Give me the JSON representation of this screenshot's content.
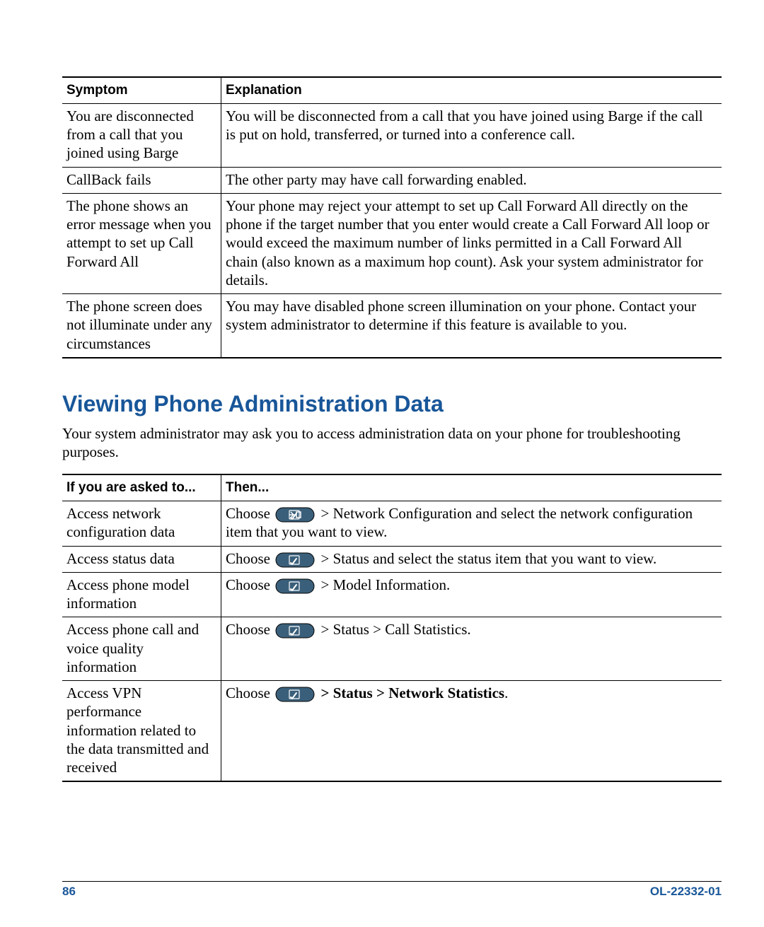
{
  "table1": {
    "headers": [
      "Symptom",
      "Explanation"
    ],
    "rows": [
      {
        "symptom": "You are disconnected from a call that you joined using Barge",
        "explanation": "You will be disconnected from a call that you have joined using Barge if the call is put on hold, transferred, or turned into a conference call."
      },
      {
        "symptom": "CallBack fails",
        "explanation": "The other party may have call forwarding enabled."
      },
      {
        "symptom": "The phone shows an error message when you attempt to set up Call Forward All",
        "explanation": "Your phone may reject your attempt to set up Call Forward All directly on the phone if the target number that you enter would create a Call Forward All loop or would exceed the maximum number of links permitted in a Call Forward All chain (also known as a maximum hop count). Ask your system administrator for details."
      },
      {
        "symptom": "The phone screen does not illuminate under any circumstances",
        "explanation": "You may have disabled phone screen illumination on your phone. Contact your system administrator to determine if this feature is available to you."
      }
    ]
  },
  "heading": "Viewing Phone Administration Data",
  "intro": "Your system administrator may ask you to access administration data on your phone for troubleshooting purposes.",
  "table2": {
    "headers": [
      "If you are asked to...",
      "Then..."
    ],
    "rows": [
      {
        "asked": "Access network configuration data",
        "choose": "Choose",
        "after": " > Network Configuration and select the network configuration item that you want to view."
      },
      {
        "asked": "Access status data",
        "choose": "Choose",
        "after": " > Status and select the status item that you want to view."
      },
      {
        "asked": "Access phone model information",
        "choose": "Choose",
        "after": " > Model Information."
      },
      {
        "asked": "Access phone call and voice quality information",
        "choose": "Choose",
        "after": " > Status > Call Statistics."
      },
      {
        "asked": "Access VPN performance information related to the data transmitted and received",
        "choose": "Choose",
        "after_bold": " > Status > Network Statistics",
        "after_trailing": "."
      }
    ]
  },
  "footer": {
    "page": "86",
    "doc": "OL-22332-01"
  }
}
